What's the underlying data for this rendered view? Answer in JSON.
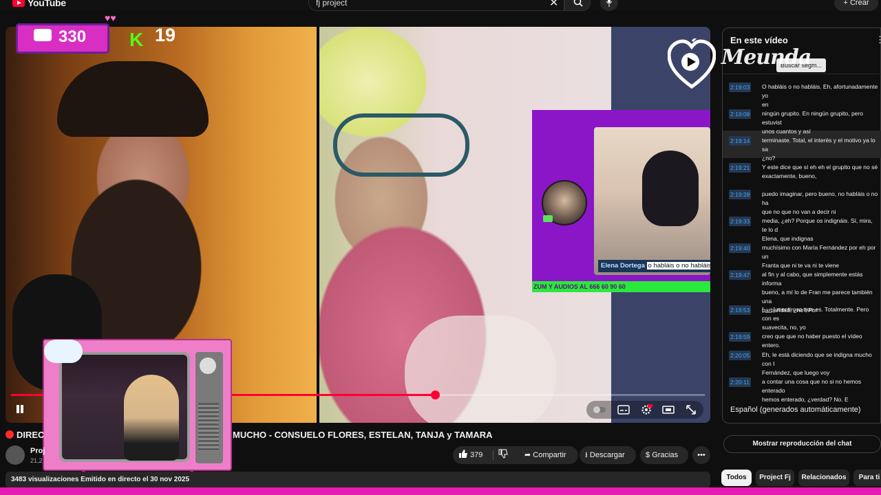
{
  "header": {
    "logo_text": "YouTube",
    "search_value": "fj project",
    "create_label": "Crear"
  },
  "overlay": {
    "viewer_count": "330",
    "kick_count": "19"
  },
  "stream_inset": {
    "guest_name": "Elena Dortega",
    "caption_snippet": "o habláis o no habláis",
    "ticker": "ZUM Y AUDIOS AL 666 60 90 60"
  },
  "video": {
    "progress_fraction": 0.611
  },
  "title": {
    "part_left": "DIREC",
    "part_right": "MUCHO - CONSUELO FLORES, ESTELAN, TANJA y TAMARA"
  },
  "channel": {
    "name": "Proj",
    "subs": "21,2"
  },
  "actions": {
    "likes": "379",
    "share": "Compartir",
    "download": "Descargar",
    "thanks": "Gracias"
  },
  "meta": {
    "views_line": "3483 visualizaciones  Emitido en directo el 30 nov 2025"
  },
  "transcript": {
    "title": "En este vídeo",
    "search_placeholder": "Buscar segm...",
    "watermark": "Meunda",
    "language": "Español (generados automáticamente)",
    "segments": [
      {
        "ts": "2:19:03",
        "text": "O habláis o no habláis. Eh, afortunadamente yo\nen"
      },
      {
        "ts": "2:19:08",
        "text": "ningún grupito. En ningún grupito, pero estuvist\nunos cuantos y así"
      },
      {
        "ts": "2:19:14",
        "text": "terminaste. Total, el interés y el motivo ya lo sa\n¿no?"
      },
      {
        "ts": "2:19:21",
        "text": "Y este dice que sí eh eh el grupito que no sé\nexactamente, bueno,"
      },
      {
        "ts": "2:19:28",
        "text": "puedo imaginar, pero bueno, no habláis o no ha\nque no que no van a decir ni"
      },
      {
        "ts": "2:19:33",
        "text": "media, ¿eh? Porque os indignáis. Sí, mira, te lo d\nElena, que indignas"
      },
      {
        "ts": "2:19:40",
        "text": "muchísimo con María Fernández por eh por un\nFranta que ni te va ni te viene"
      },
      {
        "ts": "2:19:47",
        "text": "al fin y al cabo, que simplemente estás informa\nbueno, a mí lo de Fran me parece también una\nbarbaridad, ¿no? Por"
      },
      {
        "ts": "2:19:53",
        "text": "[ __ ] mentiroso que es. Totalmente. Pero con es\nsuavecita, no, yo"
      },
      {
        "ts": "2:19:59",
        "text": "creo que que no haber puesto el vídeo entero."
      },
      {
        "ts": "2:20:05",
        "text": "Eh, le está diciendo que se indigna mucho con I\nFernández, que luego voy"
      },
      {
        "ts": "2:20:11",
        "text": "a contar una cosa que no si no hemos enterado\nhemos enterado, ¿verdad? No. E"
      }
    ]
  },
  "chat_replay": "Mostrar reproducción del chat",
  "chips": [
    "Todos",
    "Project Fj",
    "Relacionados",
    "Para ti"
  ],
  "colors": {
    "accent_red": "#ff0033",
    "overlay_pink": "#d92ec3",
    "kick_green": "#53fc18",
    "inset_purple": "#8a16c8",
    "timestamp_blue": "#3ea6ff"
  }
}
